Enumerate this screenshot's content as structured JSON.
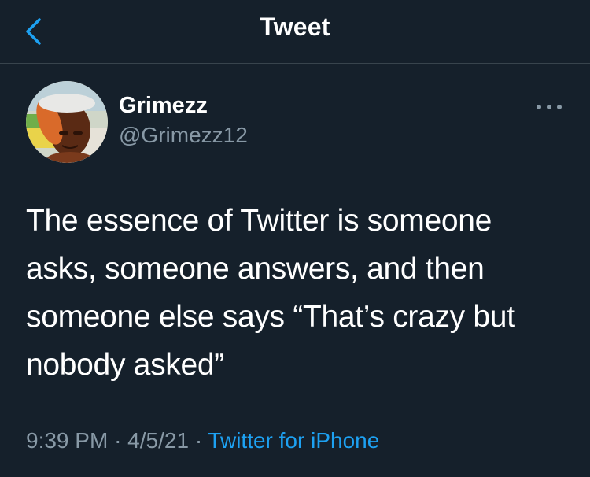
{
  "navbar": {
    "title": "Tweet"
  },
  "author": {
    "name": "Grimezz",
    "handle": "@Grimezz12"
  },
  "tweet": {
    "text": "The essence of Twitter is someone asks, someone answers, and then someone else says “That’s crazy but nobody asked”"
  },
  "meta": {
    "time": "9:39 PM",
    "separator": "·",
    "date": "4/5/21",
    "source": "Twitter for iPhone"
  },
  "icons": {
    "back": "chevron-left-icon",
    "more": "more-horizontal-icon"
  },
  "colors": {
    "background": "#15202b",
    "accent": "#1da1f2",
    "secondary_text": "#8899a6",
    "divider": "#38444d"
  }
}
